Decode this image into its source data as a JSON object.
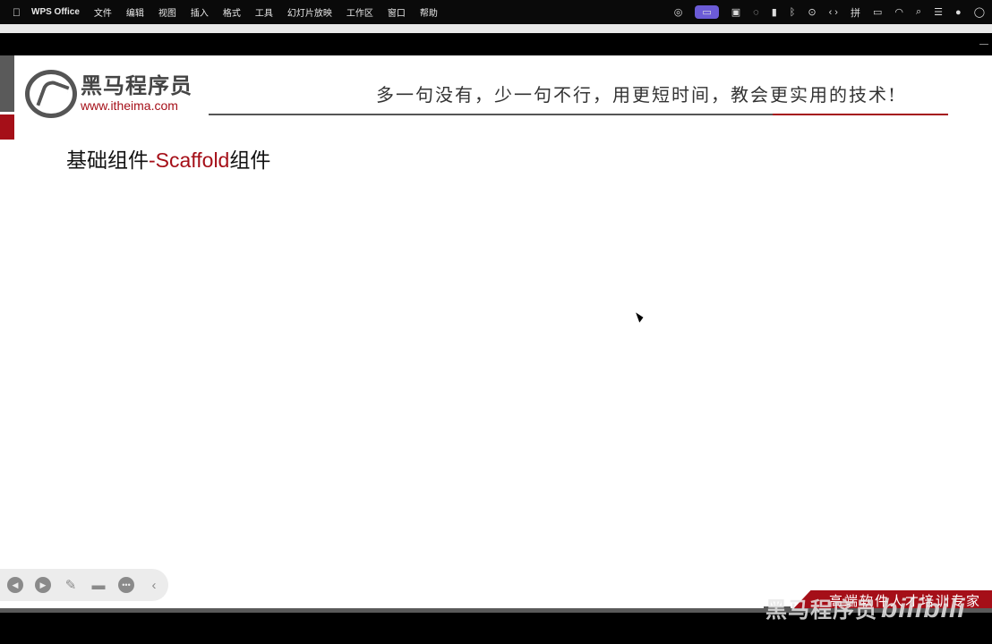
{
  "menubar": {
    "app": "WPS Office",
    "items": [
      "文件",
      "编辑",
      "视图",
      "插入",
      "格式",
      "工具",
      "幻灯片放映",
      "工作区",
      "窗口",
      "帮助"
    ],
    "ime": "拼"
  },
  "slide": {
    "brand": "黑马程序员",
    "url": "www.itheima.com",
    "slogan": "多一句没有，少一句不行，用更短时间，教会更实用的技术!",
    "title_prefix": "基础组件",
    "title_highlight": "-Scaffold",
    "title_suffix": "组件",
    "banner": "高端软件人才培训专家"
  },
  "watermark": {
    "brand": "黑马程序员",
    "site": "bilibili"
  },
  "colors": {
    "accent": "#a50f18",
    "menubar": "#0a0a0a"
  }
}
